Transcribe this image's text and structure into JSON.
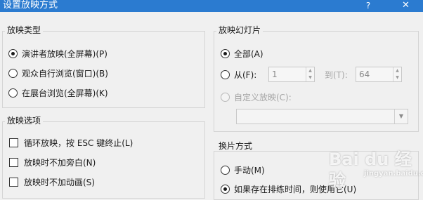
{
  "dialog": {
    "title": "设置放映方式",
    "help_label": "?",
    "close_label": "✕"
  },
  "show_type": {
    "label": "放映类型",
    "options": [
      {
        "label": "演讲者放映(全屏幕)(P)",
        "checked": true
      },
      {
        "label": "观众自行浏览(窗口)(B)",
        "checked": false
      },
      {
        "label": "在展台浏览(全屏幕)(K)",
        "checked": false
      }
    ]
  },
  "show_options": {
    "label": "放映选项",
    "items": [
      {
        "label": "循环放映，按 ESC 键终止(L)",
        "checked": false
      },
      {
        "label": "放映时不加旁白(N)",
        "checked": false
      },
      {
        "label": "放映时不加动画(S)",
        "checked": false
      }
    ]
  },
  "show_slides": {
    "label": "放映幻灯片",
    "all_label": "全部(A)",
    "from_label": "从(F):",
    "from_value": "1",
    "to_label": "到(T):",
    "to_value": "64",
    "custom_label": "自定义放映(C):",
    "custom_value": ""
  },
  "advance": {
    "label": "换片方式",
    "manual_label": "手动(M)",
    "timing_label": "如果存在排练时间，则使用它(U)"
  },
  "watermark": {
    "text": "Bai du 经验",
    "url": "jingyan.baidu.com"
  }
}
